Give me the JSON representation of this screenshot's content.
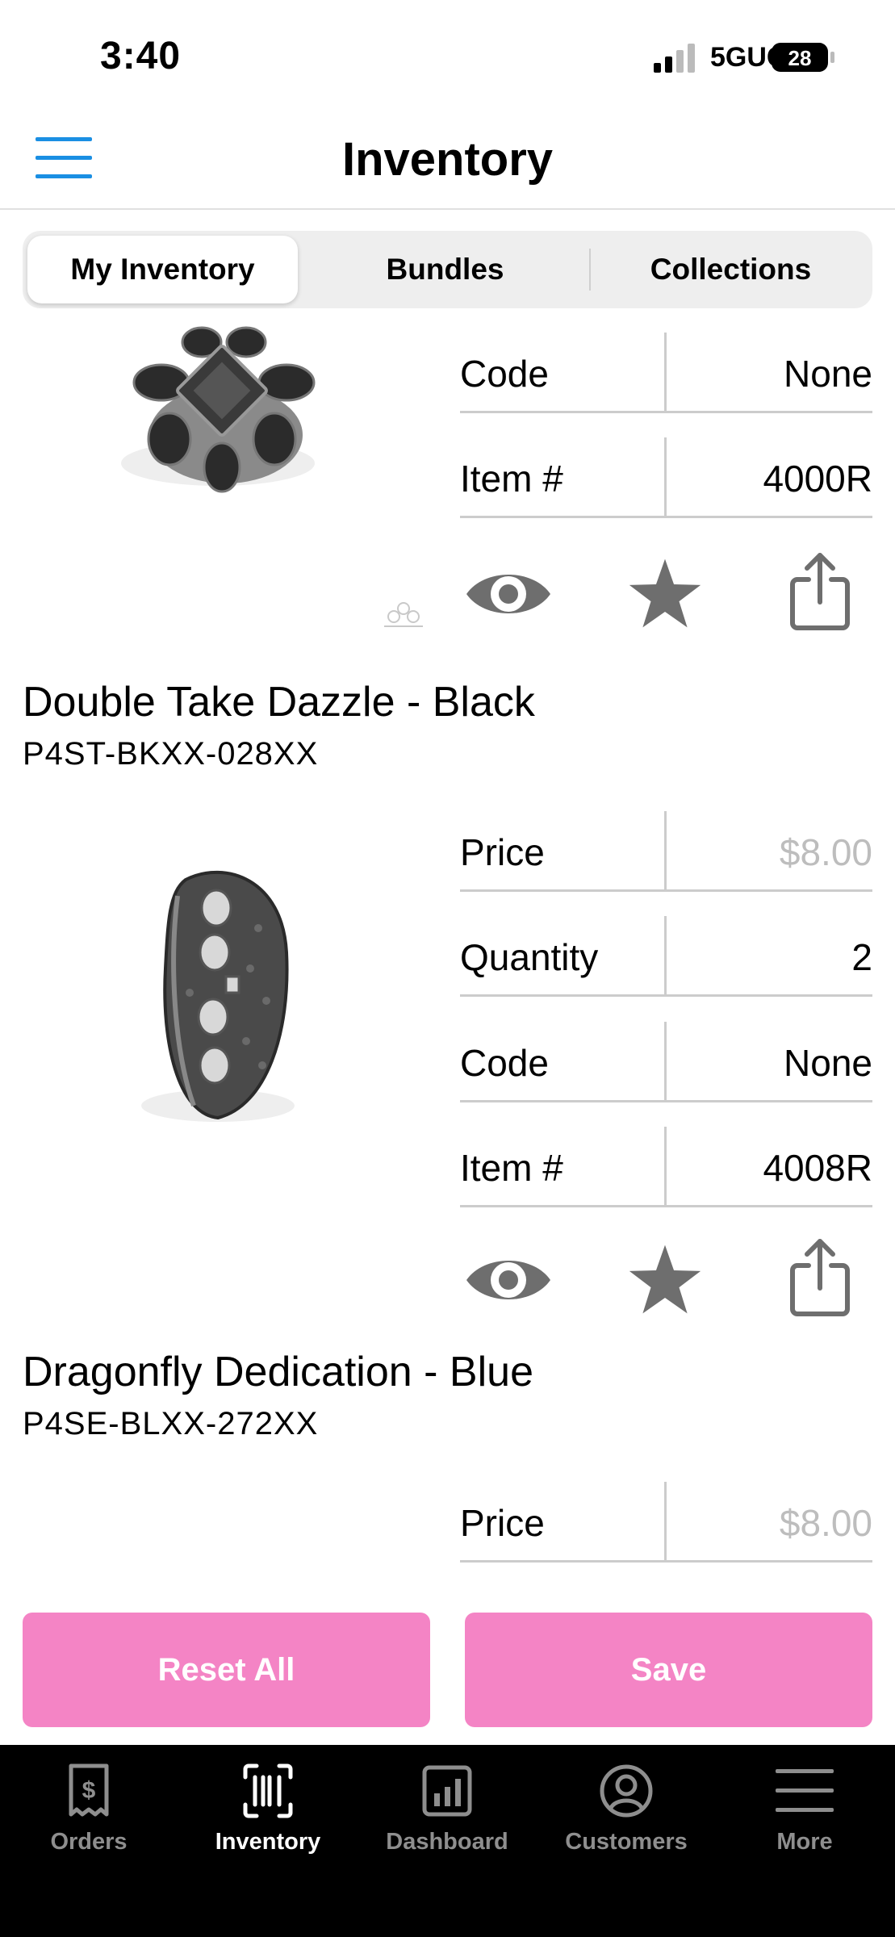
{
  "status_bar": {
    "time": "3:40",
    "network": "5GUC",
    "battery": "28"
  },
  "nav": {
    "title": "Inventory",
    "menu_icon": "hamburger-menu-icon"
  },
  "segments": [
    {
      "label": "My Inventory",
      "selected": true
    },
    {
      "label": "Bundles",
      "selected": false
    },
    {
      "label": "Collections",
      "selected": false
    }
  ],
  "items": [
    {
      "title": "",
      "sku": "",
      "rows": [
        {
          "label": "Code",
          "value": "None",
          "muted": false
        },
        {
          "label": "Item #",
          "value": "4000R",
          "muted": false
        }
      ]
    },
    {
      "title": "Double Take Dazzle - Black",
      "sku": "P4ST-BKXX-028XX",
      "rows": [
        {
          "label": "Price",
          "value": "$8.00",
          "muted": true
        },
        {
          "label": "Quantity",
          "value": "2",
          "muted": false
        },
        {
          "label": "Code",
          "value": "None",
          "muted": false
        },
        {
          "label": "Item #",
          "value": "4008R",
          "muted": false
        }
      ]
    },
    {
      "title": "Dragonfly Dedication - Blue",
      "sku": "P4SE-BLXX-272XX",
      "rows": [
        {
          "label": "Price",
          "value": "$8.00",
          "muted": true
        }
      ]
    }
  ],
  "actions": {
    "icons": [
      "eye-icon",
      "star-icon",
      "share-icon"
    ]
  },
  "buttons": {
    "reset": "Reset All",
    "save": "Save"
  },
  "colors": {
    "accent_pink": "#f484c5",
    "menu_blue": "#1a8fe3",
    "icon_gray": "#6e6e6e"
  },
  "tabs": [
    {
      "label": "Orders",
      "icon": "receipt-dollar-icon",
      "active": false
    },
    {
      "label": "Inventory",
      "icon": "barcode-icon",
      "active": true
    },
    {
      "label": "Dashboard",
      "icon": "bar-chart-icon",
      "active": false
    },
    {
      "label": "Customers",
      "icon": "person-circle-icon",
      "active": false
    },
    {
      "label": "More",
      "icon": "more-lines-icon",
      "active": false
    }
  ]
}
